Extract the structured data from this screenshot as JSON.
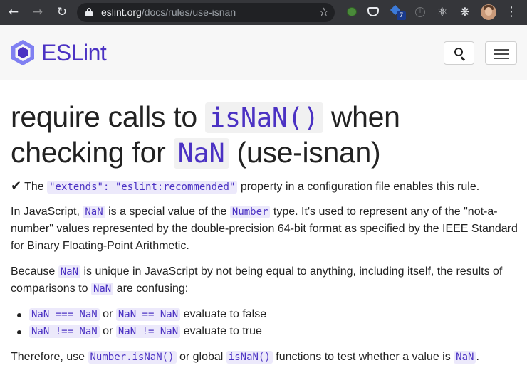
{
  "browser": {
    "url_host": "eslint.org",
    "url_path": "/docs/rules/use-isnan",
    "extension_badge_count": "7"
  },
  "header": {
    "brand": "ESLint",
    "brand_color": "#4b32c3"
  },
  "page": {
    "title": {
      "part1": "require calls to ",
      "code1": "isNaN()",
      "part2": " when checking for ",
      "code2": "NaN",
      "part3": " (use-isnan)"
    },
    "recommended": {
      "prefix": "The ",
      "code": "\"extends\": \"eslint:recommended\"",
      "suffix": " property in a configuration file enables this rule."
    },
    "p1": {
      "t1": "In JavaScript, ",
      "c1": "NaN",
      "t2": " is a special value of the ",
      "c2": "Number",
      "t3": " type. It's used to represent any of the \"not-a-number\" values represented by the double-precision 64-bit format as specified by the IEEE Standard for Binary Floating-Point Arithmetic."
    },
    "p2": {
      "t1": "Because ",
      "c1": "NaN",
      "t2": " is unique in JavaScript by not being equal to anything, including itself, the results of comparisons to ",
      "c2": "NaN",
      "t3": " are confusing:"
    },
    "list": [
      {
        "c1": "NaN === NaN",
        "or": " or ",
        "c2": "NaN == NaN",
        "tail": " evaluate to false"
      },
      {
        "c1": "NaN !== NaN",
        "or": " or ",
        "c2": "NaN != NaN",
        "tail": " evaluate to true"
      }
    ],
    "p3": {
      "t1": "Therefore, use ",
      "c1": "Number.isNaN()",
      "t2": " or global ",
      "c2": "isNaN()",
      "t3": " functions to test whether a value is ",
      "c3": "NaN",
      "t4": "."
    }
  }
}
